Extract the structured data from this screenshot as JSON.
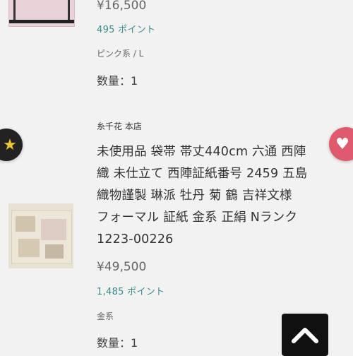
{
  "items": [
    {
      "price": "¥16,500",
      "points": "495 ポイント",
      "variant": "ピンク系 / L",
      "quantity": "数量：1"
    },
    {
      "shop": "糸千花 本店",
      "title_lines": [
        "未使用品 袋帯 帯丈440cm 六通 西陣",
        "織 未仕立て 西陣証紙番号 2459 五島",
        "織物謹製 琳派 牡丹 菊 鶴 吉祥文様",
        "フォーマル 証紙 金系 正絹 Nランク",
        "1223-00226"
      ],
      "price": "¥49,500",
      "points": "1,485 ポイント",
      "variant": "金系",
      "quantity": "数量：1"
    }
  ],
  "icons": {
    "favorite_left": "star-icon",
    "favorite_right": "heart-icon",
    "back_to_top": "chevron-up-icon"
  },
  "colors": {
    "points_text": "#3a8a8a",
    "heart_button": "#e05a6e",
    "star": "#f2c331"
  }
}
